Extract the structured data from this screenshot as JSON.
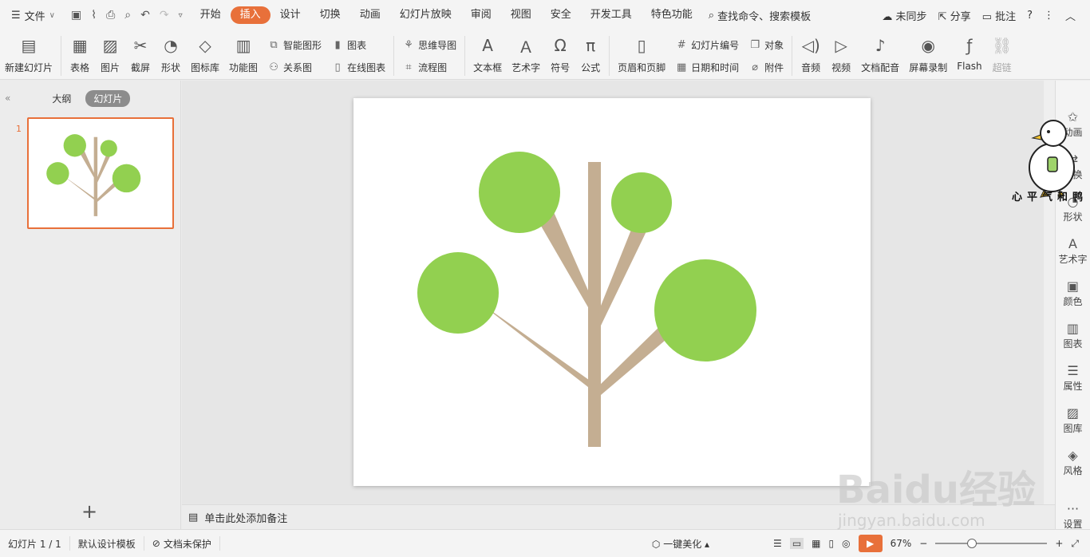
{
  "menu": {
    "file_label": "文件",
    "tabs": [
      {
        "label": "开始",
        "active": false
      },
      {
        "label": "插入",
        "active": true
      },
      {
        "label": "设计",
        "active": false
      },
      {
        "label": "切换",
        "active": false
      },
      {
        "label": "动画",
        "active": false
      },
      {
        "label": "幻灯片放映",
        "active": false
      },
      {
        "label": "审阅",
        "active": false
      },
      {
        "label": "视图",
        "active": false
      },
      {
        "label": "安全",
        "active": false
      },
      {
        "label": "开发工具",
        "active": false
      },
      {
        "label": "特色功能",
        "active": false
      }
    ],
    "search": "查找命令、搜索模板",
    "sync": "未同步",
    "share": "分享",
    "comment": "批注"
  },
  "ribbon": {
    "new_slide": "新建幻灯片",
    "table": "表格",
    "picture": "图片",
    "screenshot": "截屏",
    "shape": "形状",
    "icon_lib": "图标库",
    "func_chart": "功能图",
    "smart_shape": "智能图形",
    "chart": "图表",
    "relation": "关系图",
    "online_chart": "在线图表",
    "mindmap": "思维导图",
    "flowchart": "流程图",
    "textbox": "文本框",
    "wordart": "艺术字",
    "symbol": "符号",
    "formula": "公式",
    "header_footer": "页眉和页脚",
    "slide_number": "幻灯片编号",
    "object": "对象",
    "datetime": "日期和时间",
    "attachment": "附件",
    "audio": "音频",
    "video": "视频",
    "doc_dub": "文档配音",
    "screen_record": "屏幕录制",
    "flash": "Flash",
    "hyperlink": "超链"
  },
  "left_panel": {
    "outline_tab": "大纲",
    "slides_tab": "幻灯片",
    "thumb_number": "1"
  },
  "notes": {
    "placeholder": "单击此处添加备注"
  },
  "right_sidebar": [
    {
      "label": "动画"
    },
    {
      "label": "切换"
    },
    {
      "label": "形状"
    },
    {
      "label": "艺术字"
    },
    {
      "label": "颜色"
    },
    {
      "label": "图表"
    },
    {
      "label": "属性"
    },
    {
      "label": "图库"
    },
    {
      "label": "风格"
    },
    {
      "label": "设置"
    }
  ],
  "status": {
    "slide_info": "幻灯片 1 / 1",
    "template": "默认设计模板",
    "protect": "文档未保护",
    "beautify": "一键美化",
    "zoom": "67%"
  },
  "slide": {
    "colors": {
      "leaf": "#92d050",
      "trunk": "#c4ae92"
    }
  },
  "watermark": {
    "brand": "Baidu经验",
    "url": "jingyan.baidu.com",
    "duck_text": "心平气和鸭"
  },
  "colors": {
    "accent": "#e8703a"
  }
}
